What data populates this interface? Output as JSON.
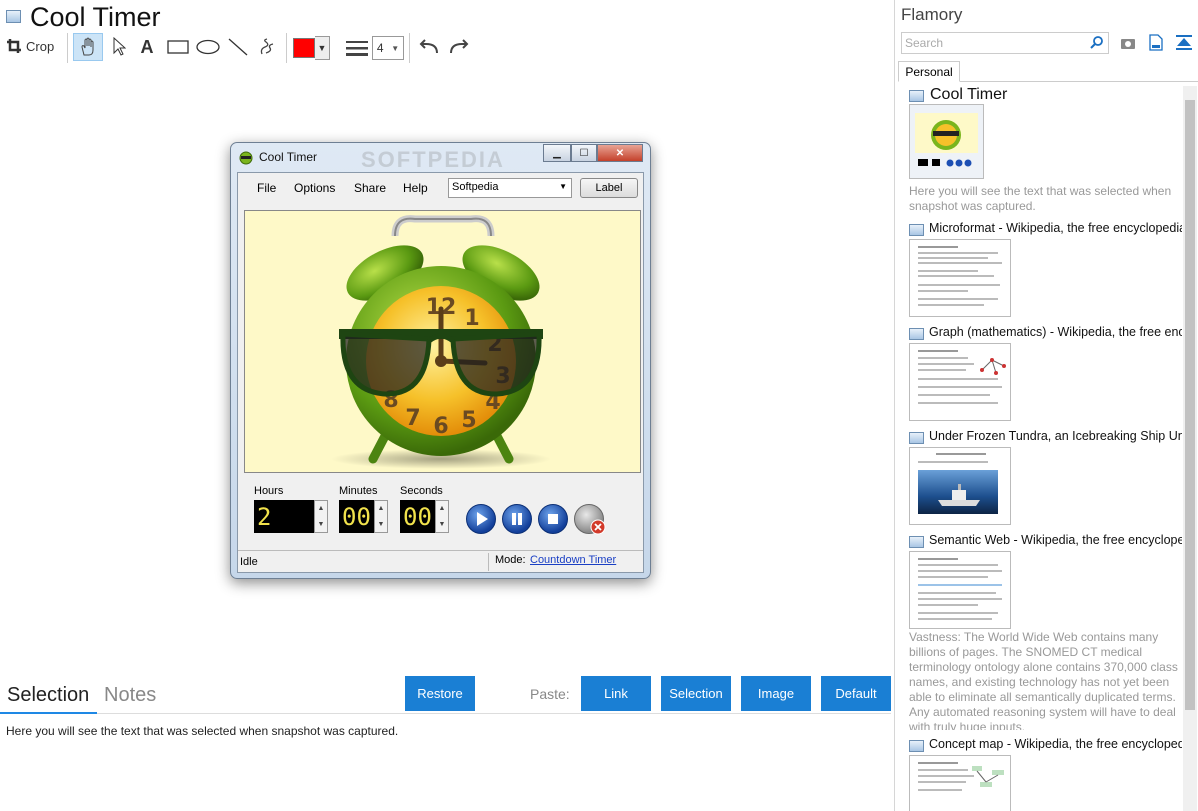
{
  "app": {
    "title": "Cool Timer"
  },
  "toolbar": {
    "crop_label": "Crop",
    "text_tool_glyph": "A",
    "line_width": "4",
    "color": "#ff0000"
  },
  "snapshot": {
    "window_title": "Cool Timer",
    "watermark": "SOFTPEDIA",
    "menu": [
      "File",
      "Options",
      "Share",
      "Help"
    ],
    "combo_value": "Softpedia",
    "label_button": "Label",
    "clock_numbers": {
      "n12": "12",
      "n1": "1",
      "n2": "2",
      "n3": "3",
      "n4": "4",
      "n5": "5",
      "n6": "6",
      "n7": "7",
      "n8": "8"
    },
    "hours_label": "Hours",
    "minutes_label": "Minutes",
    "seconds_label": "Seconds",
    "hours_value": "2",
    "minutes_value": "00",
    "seconds_value": "00",
    "status": "Idle",
    "mode_label": "Mode:",
    "mode_link": "Countdown Timer"
  },
  "tabs": {
    "selection": "Selection",
    "notes": "Notes"
  },
  "buttons": {
    "restore": "Restore",
    "paste_label": "Paste:",
    "link": "Link",
    "selection": "Selection",
    "image": "Image",
    "default": "Default"
  },
  "selection_text": "Here you will see the text that was selected when snapshot was captured.",
  "right_panel": {
    "title": "Flamory",
    "search_placeholder": "Search",
    "tab": "Personal",
    "first_item": {
      "title": "Cool Timer",
      "desc": "Here you will see the text that was selected when snapshot was captured."
    },
    "items": [
      "Microformat - Wikipedia, the free encyclopedia",
      "Graph (mathematics) - Wikipedia, the free ency",
      "Under Frozen Tundra, an Icebreaking Ship Unco",
      "Semantic Web - Wikipedia, the free encycloped",
      "Concept map - Wikipedia, the free encyclopedi"
    ],
    "semantic_desc": "Vastness: The World Wide Web contains many billions of pages. The SNOMED CT medical terminology ontology alone contains 370,000 class names, and existing technology has not yet been able to eliminate all semantically duplicated terms. Any automated reasoning system will have to deal with truly huge inputs."
  }
}
